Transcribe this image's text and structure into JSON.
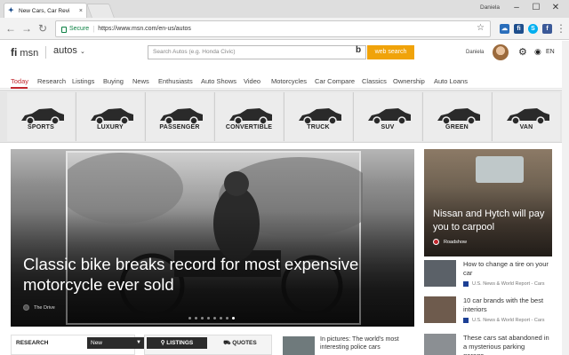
{
  "browser": {
    "tab_title": "New Cars, Car Revi",
    "tab_favicon": "msn-icon",
    "user_name": "Daniela",
    "secure_label": "Secure",
    "url": "https://www.msn.com/en-us/autos"
  },
  "header": {
    "logo_text": "msn",
    "section_label": "autos",
    "search_placeholder": "Search Autos (e.g. Honda Civic)",
    "search_button": "web search",
    "user_name": "Daniela",
    "language": "EN"
  },
  "nav": {
    "items": [
      "Today",
      "Research",
      "Listings",
      "Buying",
      "News",
      "Enthusiasts",
      "Auto Shows",
      "Video",
      "Motorcycles",
      "Car Compare",
      "Classics",
      "Ownership",
      "Auto Loans"
    ],
    "active_index": 0
  },
  "categories": [
    "SPORTS",
    "LUXURY",
    "PASSENGER",
    "CONVERTIBLE",
    "TRUCK",
    "SUV",
    "GREEN",
    "VAN"
  ],
  "hero": {
    "title": "Classic bike breaks record for most expensive motorcycle ever sold",
    "source": "The Drive",
    "slide_count": 8,
    "active_slide": 7
  },
  "feature_card": {
    "title": "Nissan and Hytch will pay you to carpool",
    "source": "Roadshow"
  },
  "right_list": [
    {
      "title": "How to change a tire on your car",
      "source": "U.S. News & World Report - Cars"
    },
    {
      "title": "10 car brands with the best interiors",
      "source": "U.S. News & World Report - Cars"
    },
    {
      "title": "These cars sat abandoned in a mysterious parking garage...",
      "source": ""
    }
  ],
  "bottom": {
    "research_label": "RESEARCH",
    "research_select": "New",
    "listings_tab": "LISTINGS",
    "quotes_tab": "QUOTES",
    "story_title": "In pictures: The world's most interesting police cars"
  },
  "colors": {
    "accent": "#c1272d",
    "search_button": "#f0a30a",
    "secure": "#0b8043"
  }
}
